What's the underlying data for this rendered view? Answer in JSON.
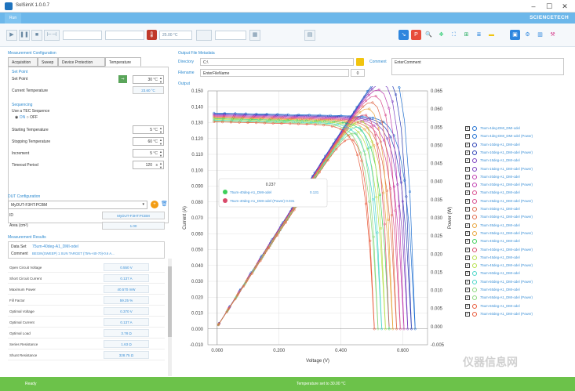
{
  "window": {
    "title": "SolSimX 1.0.0.7",
    "brand": "SCIENCETECH"
  },
  "ribbon": {
    "tab": "Run"
  },
  "toolbar": {
    "temp_field": "25.00 °C"
  },
  "measurement_config": {
    "title": "Measurement Configuration",
    "tabs": [
      "Acquisition",
      "Sweep",
      "Device Protection",
      "Temperature"
    ],
    "active_tab": "Temperature",
    "set_point_title": "Set Point",
    "set_point_label": "Set Point",
    "set_point_value": "30",
    "set_point_unit": "°C",
    "current_temp_label": "Current Temperature",
    "current_temp_value": "23.60 °C",
    "sequencing_title": "Sequencing",
    "use_tec_label": "Use a TEC Sequence",
    "radio_on": "ON",
    "radio_off": "OFF",
    "starting_temp_label": "Starting Temperature",
    "starting_temp_value": "5",
    "stopping_temp_label": "Stopping Temperature",
    "stopping_temp_value": "60",
    "increment_label": "Increment",
    "increment_value": "5",
    "timeout_label": "Timeout Period",
    "timeout_value": "120",
    "timeout_unit": "s",
    "temp_unit": "°C"
  },
  "dut": {
    "title": "DUT Configuration",
    "select_value": "MyDUT-F3HT:PCBM",
    "id_label": "ID",
    "id_value": "MyDUT-F3HT:PCBM",
    "area_label": "Area (cm²)",
    "area_value": "1.00"
  },
  "results": {
    "title": "Measurement Results",
    "dataset_label": "Data Set",
    "dataset_value": "75um-40deg-A1_DMI-odel",
    "comment_label": "Comment",
    "comment_value": "BEGIN(SWEEP) 1 SUN TARGET (75%+40-70)-0.6 A...",
    "rows": [
      {
        "label": "Open Circuit Voltage",
        "value": "0.550 V"
      },
      {
        "label": "Short Circuit Current",
        "value": "0.137 A"
      },
      {
        "label": "Maximum Power",
        "value": "40.570 mW"
      },
      {
        "label": "Fill Factor",
        "value": "59.25 %"
      },
      {
        "label": "Optimal Voltage",
        "value": "0.370 V"
      },
      {
        "label": "Optimal Current",
        "value": "0.137 A"
      },
      {
        "label": "Optimal Load",
        "value": "3.78 Ω"
      },
      {
        "label": "Series Resistance",
        "value": "1.63 Ω"
      },
      {
        "label": "Shunt Resistance",
        "value": "328.75 Ω"
      }
    ]
  },
  "output_meta": {
    "title": "Output File Metadata",
    "directory_label": "Directory",
    "directory_value": "C:\\",
    "filename_label": "Filename",
    "filename_value": "EnterFileName",
    "filename_index": "0",
    "comment_label": "Comment",
    "comment_value": "EnterComment"
  },
  "output": {
    "title": "Output"
  },
  "tooltip": {
    "x": "0.237",
    "s1_name": "75um-40deg-A1_DMI-odel",
    "s1_value": "0.131",
    "s2_name": "75um-40deg-A1_DMI-odel (Power)",
    "s2_value": "0.031"
  },
  "chart_data": {
    "type": "line",
    "xlabel": "Voltage (V)",
    "ylabel": "Current (A)",
    "y2label": "Power (W)",
    "xlim": [
      -0.03,
      0.68
    ],
    "ylim": [
      -0.01,
      0.15
    ],
    "y2lim": [
      -0.005,
      0.065
    ],
    "xticks": [
      "0.000",
      "0.200",
      "0.400",
      "0.600"
    ],
    "yticks": [
      "0.150",
      "0.140",
      "0.130",
      "0.120",
      "0.110",
      "0.100",
      "0.090",
      "0.080",
      "0.070",
      "0.060",
      "0.050",
      "0.040",
      "0.030",
      "0.020",
      "0.010",
      "0.000",
      "-0.010"
    ],
    "y2ticks": [
      "0.065",
      "0.060",
      "0.055",
      "0.050",
      "0.045",
      "0.040",
      "0.035",
      "0.030",
      "0.025",
      "0.020",
      "0.015",
      "0.010",
      "0.005",
      "0.000",
      "-0.005"
    ],
    "grid": true,
    "series": [
      {
        "name": "75um-4deg-DMI_DMI-odel",
        "color": "#1f6fd1",
        "isc": 0.136,
        "voc": 0.64,
        "kind": "iv"
      },
      {
        "name": "75um-4deg-DMI_DMI-odel (Power)",
        "color": "#1f6fd1",
        "isc": 0.136,
        "voc": 0.64,
        "kind": "power"
      },
      {
        "name": "75um-10deg-A1_DMI-odel",
        "color": "#2a3fb5",
        "isc": 0.1355,
        "voc": 0.628,
        "kind": "iv"
      },
      {
        "name": "75um-10deg-A1_DMI-odel (Power)",
        "color": "#2a3fb5",
        "isc": 0.1355,
        "voc": 0.628,
        "kind": "power"
      },
      {
        "name": "75um-15deg-A1_DMI-odel",
        "color": "#7a3fc0",
        "isc": 0.135,
        "voc": 0.616,
        "kind": "iv"
      },
      {
        "name": "75um-15deg-A1_DMI-odel (Power)",
        "color": "#7a3fc0",
        "isc": 0.135,
        "voc": 0.616,
        "kind": "power"
      },
      {
        "name": "75um-20deg-A1_DMI-odel",
        "color": "#c03fb0",
        "isc": 0.1345,
        "voc": 0.604,
        "kind": "iv"
      },
      {
        "name": "75um-20deg-A1_DMI-odel (Power)",
        "color": "#c03fb0",
        "isc": 0.1345,
        "voc": 0.604,
        "kind": "power"
      },
      {
        "name": "75um-25deg-A1_DMI-odel",
        "color": "#d94a8c",
        "isc": 0.134,
        "voc": 0.592,
        "kind": "iv"
      },
      {
        "name": "75um-25deg-A1_DMI-odel (Power)",
        "color": "#d94a8c",
        "isc": 0.134,
        "voc": 0.592,
        "kind": "power"
      },
      {
        "name": "75um-30deg-A1_DMI-odel",
        "color": "#e06a4a",
        "isc": 0.1335,
        "voc": 0.58,
        "kind": "iv"
      },
      {
        "name": "75um-30deg-A1_DMI-odel (Power)",
        "color": "#e06a4a",
        "isc": 0.1335,
        "voc": 0.58,
        "kind": "power"
      },
      {
        "name": "75um-35deg-A1_DMI-odel",
        "color": "#e8a33a",
        "isc": 0.133,
        "voc": 0.568,
        "kind": "iv"
      },
      {
        "name": "75um-35deg-A1_DMI-odel (Power)",
        "color": "#e8a33a",
        "isc": 0.133,
        "voc": 0.568,
        "kind": "power"
      },
      {
        "name": "75um-40deg-A1_DMI-odel",
        "color": "#3ecf5a",
        "isc": 0.1325,
        "voc": 0.556,
        "kind": "iv"
      },
      {
        "name": "75um-40deg-A1_DMI-odel (Power)",
        "color": "#d94a6a",
        "isc": 0.1325,
        "voc": 0.556,
        "kind": "power"
      },
      {
        "name": "75um-45deg-A1_DMI-odel",
        "color": "#b6e04a",
        "isc": 0.132,
        "voc": 0.544,
        "kind": "iv"
      },
      {
        "name": "75um-45deg-A1_DMI-odel (Power)",
        "color": "#b6e04a",
        "isc": 0.132,
        "voc": 0.544,
        "kind": "power"
      },
      {
        "name": "75um-50deg-A1_DMI-odel",
        "color": "#4ad6c8",
        "isc": 0.1315,
        "voc": 0.532,
        "kind": "iv"
      },
      {
        "name": "75um-50deg-A1_DMI-odel (Power)",
        "color": "#4ad6c8",
        "isc": 0.1315,
        "voc": 0.532,
        "kind": "power"
      },
      {
        "name": "75um-55deg-A1_DMI-odel",
        "color": "#8ad87a",
        "isc": 0.131,
        "voc": 0.52,
        "kind": "iv"
      },
      {
        "name": "75um-55deg-A1_DMI-odel (Power)",
        "color": "#8ad87a",
        "isc": 0.131,
        "voc": 0.52,
        "kind": "power"
      },
      {
        "name": "75um-60deg-A1_DMI-odel",
        "color": "#e85a3a",
        "isc": 0.1305,
        "voc": 0.508,
        "kind": "iv"
      },
      {
        "name": "75um-60deg-A1_DMI-odel (Power)",
        "color": "#e85a3a",
        "isc": 0.1305,
        "voc": 0.508,
        "kind": "power"
      }
    ]
  },
  "status": {
    "left": "Ready",
    "center": "Temperature set to 30.00 °C"
  },
  "watermark": "仪器信息网"
}
